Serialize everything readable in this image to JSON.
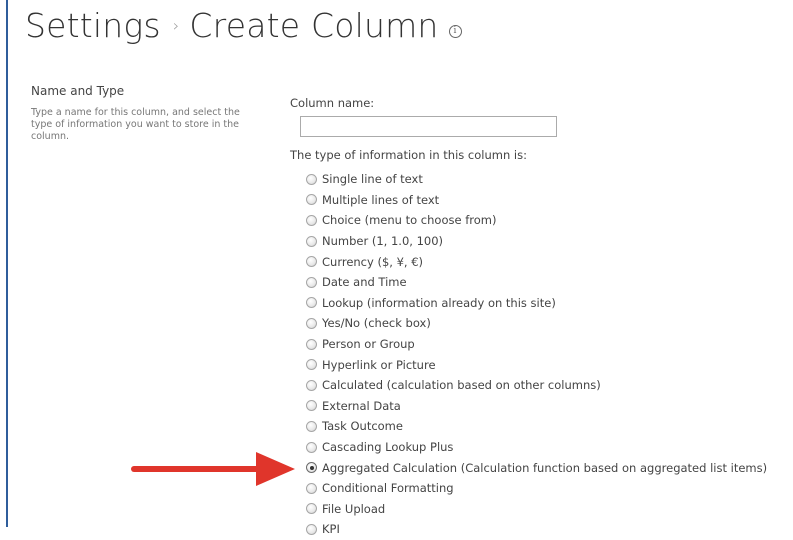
{
  "header": {
    "breadcrumb_root": "Settings",
    "breadcrumb_separator": "›",
    "page_title": "Create Column",
    "info_glyph": "i"
  },
  "name_and_type": {
    "section_title": "Name and Type",
    "description": "Type a name for this column, and select the type of information you want to store in the column.",
    "column_name_label": "Column name:",
    "column_name_value": "",
    "type_label": "The type of information in this column is:",
    "selected_option": "Aggregated Calculation (Calculation function based on aggregated list items)",
    "options": [
      "Single line of text",
      "Multiple lines of text",
      "Choice (menu to choose from)",
      "Number (1, 1.0, 100)",
      "Currency ($, ¥, €)",
      "Date and Time",
      "Lookup (information already on this site)",
      "Yes/No (check box)",
      "Person or Group",
      "Hyperlink or Picture",
      "Calculated (calculation based on other columns)",
      "External Data",
      "Task Outcome",
      "Cascading Lookup Plus",
      "Aggregated Calculation (Calculation function based on aggregated list items)",
      "Conditional Formatting",
      "File Upload",
      "KPI"
    ]
  },
  "colors": {
    "frame_border": "#2f5d9b",
    "annotation_arrow": "#e0352b"
  },
  "icons": {
    "info": "info-circle-icon",
    "annotation": "red-arrow-icon"
  }
}
